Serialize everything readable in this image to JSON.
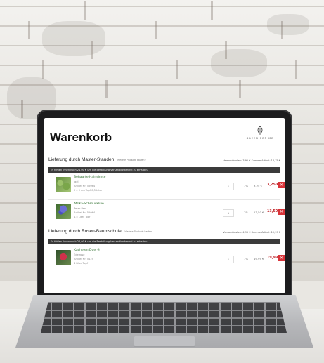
{
  "page": {
    "title": "Warenkorb",
    "brand": "GREEN FOR ME"
  },
  "colors": {
    "header_bar": "#3b3b3b",
    "price_red": "#c0262b",
    "delete_red": "#d9343a",
    "product_green": "#2d6e2d"
  },
  "sections": [
    {
      "title": "Lieferung durch Master-Stauden",
      "more": "Weitere Produkte kaufen ›",
      "fees": "Versandkosten: 3,95 €   Summe Artikel: 16,75 €",
      "notice": "Es fehlen Ihnen noch 24,00 € um die Bestellung Versandkostenfrei zu erhalten.",
      "items": [
        {
          "name": "Behaarte Hainsimse",
          "variety": "Igel",
          "article": "Artikel Nr. 55064",
          "size": "9 x 9 cm Topf 0,5 Liter",
          "qty": "1",
          "tax": "7%",
          "unit_price": "3,25 €",
          "total": "3,25 €",
          "delete_icon": "trash-icon"
        },
        {
          "name": "Afrika-Schmucklilie",
          "variety": "Peter Pan",
          "article": "Artikel Nr. 55064",
          "size": "1,5 Liter Topf",
          "qty": "1",
          "tax": "7%",
          "unit_price": "13,50 €",
          "total": "13,50 €",
          "delete_icon": "trash-icon"
        }
      ]
    },
    {
      "title": "Lieferung durch Rosen-Baumschule",
      "more": "Weitere Produkte kaufen ›",
      "fees": "Versandkosten: 4,95 €   Summe Artikel: 19,99 €",
      "notice": "Es fehlen Ihnen noch 26,00 € um die Bestellung Versandkostenfrei zu erhalten.",
      "items": [
        {
          "name": "Kachelen Duer®",
          "variety": "Edelrose",
          "article": "Artikel Nr. 5125",
          "size": "4 Liter Topf",
          "qty": "1",
          "tax": "7%",
          "unit_price": "19,99 €",
          "total": "19,99 €",
          "delete_icon": "trash-icon"
        }
      ]
    }
  ]
}
